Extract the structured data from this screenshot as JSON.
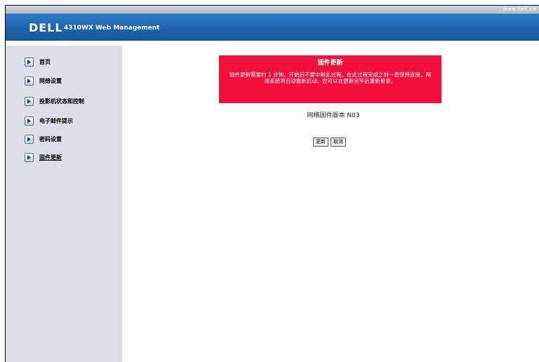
{
  "topbar": {
    "url": "www.dell.co"
  },
  "header": {
    "logo": "DELL",
    "title": "4310WX Web Management"
  },
  "sidebar": {
    "items": [
      {
        "label": "首页"
      },
      {
        "label": "网络设置"
      },
      {
        "label": "投影机状态和控制"
      },
      {
        "label": "电子邮件提示"
      },
      {
        "label": "密码设置"
      },
      {
        "label": "固件更新"
      }
    ]
  },
  "alert": {
    "title": "固件更新",
    "body": "固件更新需要约 1 分钟。开始后不要中断此过程。在此过程完成之前一直保持连接。网络系统将自动重新启动。您可以在更新完毕后重新登录。"
  },
  "firmware": {
    "version_text": "网络固件版本 N03"
  },
  "buttons": {
    "update": "更新",
    "cancel": "取消"
  },
  "colors": {
    "header": "#1d63ad",
    "alert": "#f20f3c",
    "sidebar": "#dcdfe6"
  }
}
